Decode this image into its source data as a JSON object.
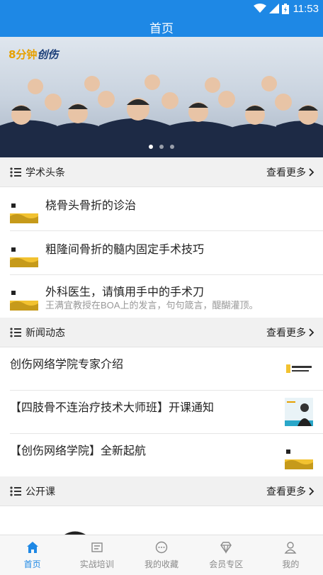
{
  "status_bar": {
    "time": "11:53"
  },
  "app_bar": {
    "title": "首页"
  },
  "banner": {
    "logo_text_a": "8分钟",
    "logo_text_b": "创伤",
    "dots": 3,
    "active_dot": 0
  },
  "sections": {
    "academic": {
      "title": "学术头条",
      "more": "查看更多"
    },
    "news": {
      "title": "新闻动态",
      "more": "查看更多"
    },
    "open_class": {
      "title": "公开课",
      "more": "查看更多"
    }
  },
  "academic_items": [
    {
      "title": "桡骨头骨折的诊治",
      "subtitle": ""
    },
    {
      "title": "粗隆间骨折的髓内固定手术技巧",
      "subtitle": ""
    },
    {
      "title": "外科医生，请慎用手中的手术刀",
      "subtitle": "王满宜教授在BOA上的发言，句句箴言，醍醐灌顶。"
    }
  ],
  "news_items": [
    {
      "title": "创伤网络学院专家介绍"
    },
    {
      "title": "【四肢骨不连治疗技术大师班】开课通知"
    },
    {
      "title": "【创伤网络学院】全新起航"
    }
  ],
  "thumb_text": "创伤网络学院",
  "bottom_nav": [
    {
      "label": "首页",
      "icon": "home-icon",
      "active": true
    },
    {
      "label": "实战培训",
      "icon": "training-icon",
      "active": false
    },
    {
      "label": "我的收藏",
      "icon": "favorites-icon",
      "active": false
    },
    {
      "label": "会员专区",
      "icon": "diamond-icon",
      "active": false
    },
    {
      "label": "我的",
      "icon": "user-icon",
      "active": false
    }
  ],
  "colors": {
    "primary": "#1e88e5",
    "thumb_yellow": "#f2c230",
    "nav_inactive": "#8a8a8a"
  }
}
